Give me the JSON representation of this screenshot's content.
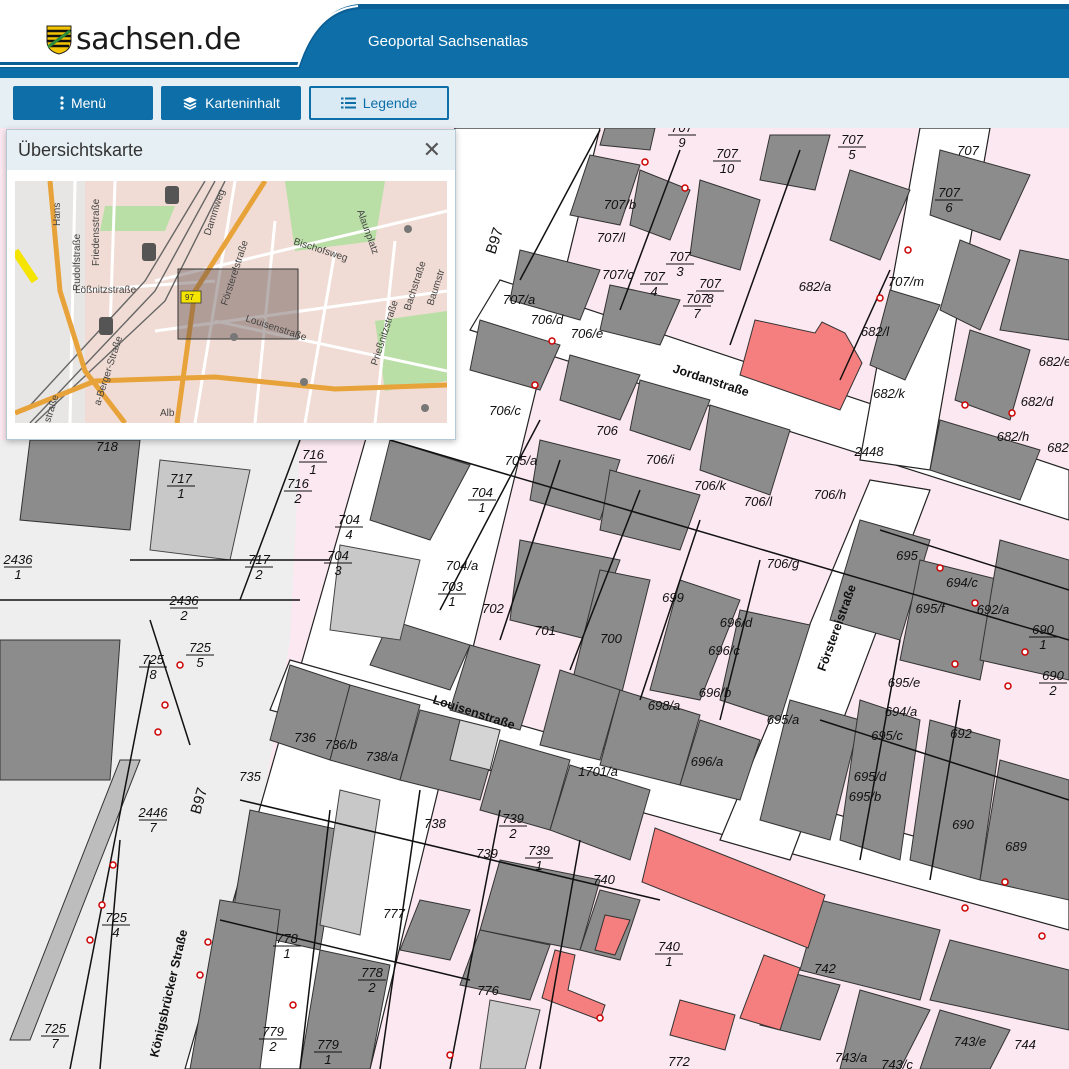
{
  "header": {
    "logo_text": "sachsen.de",
    "portal_title": "Geoportal Sachsenatlas",
    "colors": {
      "brand_blue": "#0e6ea8",
      "header_dark": "#0b5f95"
    }
  },
  "toolbar": {
    "menu_label": "Menü",
    "content_label": "Karteninhalt",
    "legend_label": "Legende"
  },
  "overview": {
    "title": "Übersichtskarte",
    "close_icon": "close-icon",
    "streets": [
      "Hans",
      "Rudolfstraße",
      "Friedensstraße",
      "Dammweg",
      "Alaunplatz",
      "Bischofsweg",
      "Lößnitzstraße",
      "Försterelstraße",
      "Louisenstraße",
      "Bachstraße",
      "Baumstr",
      "Prießnitzstraße",
      "a-Berger-Straße",
      "straße",
      "Alb"
    ],
    "road_badge": "97"
  },
  "map": {
    "street_names": [
      "Jordanstraße",
      "Louisenstraße",
      "Förstereistraße",
      "Königsbrücker Straße"
    ],
    "road_labels": [
      "B97",
      "B97"
    ],
    "parcels": [
      "707/9",
      "707/10",
      "707/5",
      "707",
      "707/6",
      "707/b",
      "707/l",
      "707/c",
      "707/4",
      "707/3",
      "707/8",
      "707/7",
      "707/a",
      "707/m",
      "682/a",
      "682/l",
      "682/k",
      "682/e",
      "682/d",
      "682/h",
      "682",
      "706/d",
      "706/e",
      "706/c",
      "706",
      "706/i",
      "706/k",
      "706/l",
      "706/h",
      "706/g",
      "705/a",
      "704/1",
      "704/4",
      "704/3",
      "704/a",
      "703/1",
      "702",
      "701",
      "700",
      "699",
      "696/d",
      "696/c",
      "696/b",
      "696/a",
      "698/a",
      "695/a",
      "695",
      "694/c",
      "695/f",
      "692/a",
      "690/1",
      "690/2",
      "695/e",
      "694/a",
      "695/c",
      "692",
      "695/d",
      "695/b",
      "690",
      "689",
      "2448",
      "718",
      "717/1",
      "716/1",
      "716/2",
      "717/2",
      "2436/1",
      "2436/2",
      "725/8",
      "725/5",
      "736",
      "736/b",
      "738/a",
      "735",
      "1701/a",
      "2446/7",
      "738",
      "739/2",
      "739",
      "739/1",
      "740",
      "777",
      "740/1",
      "742",
      "725/4",
      "778/1",
      "778/2",
      "776",
      "779/2",
      "779/1",
      "772",
      "743/a",
      "743/c",
      "743/e",
      "744",
      "725/7"
    ],
    "colors": {
      "parcel_pink": "#fce8f0",
      "building_gray": "#8c8c8c",
      "highlight_red": "#f57f7f",
      "street_white": "#ffffff"
    }
  }
}
